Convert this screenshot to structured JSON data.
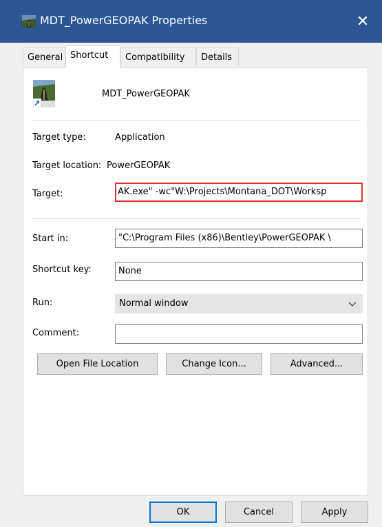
{
  "window": {
    "title": "MDT_PowerGEOPAK Properties",
    "close_glyph": "✕",
    "title_icon": "road-shortcut-icon"
  },
  "tabs": [
    {
      "label": "General",
      "active": false
    },
    {
      "label": "Shortcut",
      "active": true
    },
    {
      "label": "Compatibility",
      "active": false
    },
    {
      "label": "Details",
      "active": false
    }
  ],
  "shortcut": {
    "icon": "road-shortcut-icon",
    "name": "MDT_PowerGEOPAK",
    "target_type_label": "Target type:",
    "target_type": "Application",
    "target_location_label": "Target location:",
    "target_location": "PowerGEOPAK",
    "target_label": "Target:",
    "target": "AK.exe\" -wc\"W:\\Projects\\Montana_DOT\\Worksp",
    "start_in_label": "Start in:",
    "start_in": "\"C:\\Program Files (x86)\\Bentley\\PowerGEOPAK \\",
    "shortcut_key_label": "Shortcut key:",
    "shortcut_key": "None",
    "run_label": "Run:",
    "run": "Normal window",
    "comment_label": "Comment:",
    "comment": ""
  },
  "buttons": {
    "open_file_location": "Open File Location",
    "change_icon": "Change Icon...",
    "advanced": "Advanced..."
  },
  "footer": {
    "ok": "OK",
    "cancel": "Cancel",
    "apply": "Apply"
  },
  "colors": {
    "titlebar": "#2b5797",
    "target_highlight": "#e0322e",
    "default_button": "#0078d7"
  }
}
